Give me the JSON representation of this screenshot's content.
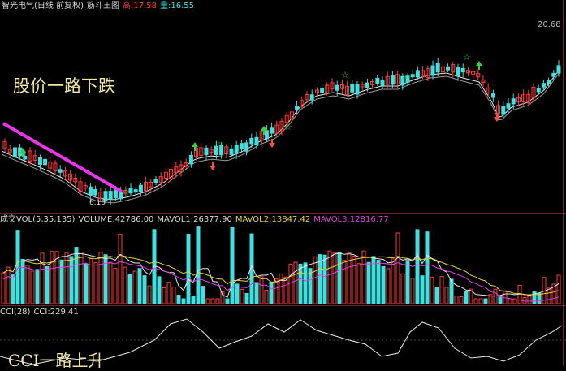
{
  "main_header": {
    "name": "智光电气(日线 前复权)",
    "indicator": "筋斗王图",
    "high_label": "高:17.58",
    "vol_label": "量:16.55"
  },
  "price_axis": {
    "top_value": "20.68",
    "low_marker": "6.15"
  },
  "annotations": {
    "price_note": "股价一路下跌",
    "cci_note": "CCI一路上升"
  },
  "volume_header": {
    "name": "成交VOL(5,35,135)",
    "volume": "VOLUME:42786.00",
    "mavol1": "MAVOL1:26377.90",
    "mavol2": "MAVOL2:13847.42",
    "mavol3": "MAVOL3:12816.77"
  },
  "cci_header": {
    "name": "CCI(28)",
    "value": "CCI:229.41"
  },
  "colors": {
    "up": "#ff3b3b",
    "down": "#40e0e0",
    "trend": "#e836e8",
    "ma": "#cfcfcf",
    "grid": "#7a1f1f"
  }
}
